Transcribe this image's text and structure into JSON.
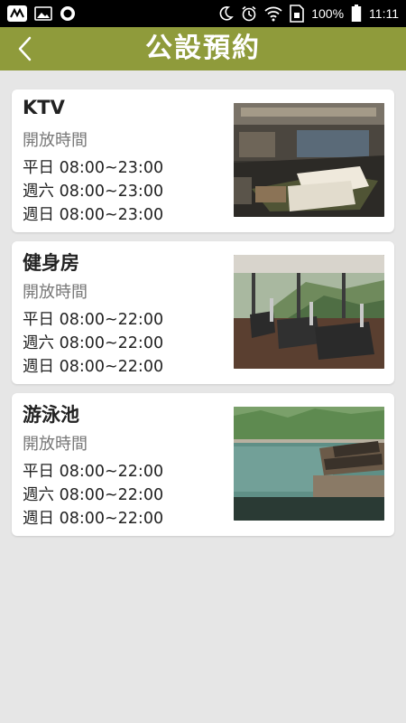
{
  "status_bar": {
    "battery": "100%",
    "time": "11:11",
    "icons": [
      "asus-logo-icon",
      "image-icon",
      "record-icon",
      "moon-icon",
      "alarm-icon",
      "wifi-icon",
      "sim-icon",
      "battery-icon"
    ]
  },
  "header": {
    "title": "公設預約",
    "back_icon": "chevron-left-icon",
    "color": "#8f9b3b"
  },
  "facilities": [
    {
      "name": "KTV",
      "subtitle": "開放時間",
      "hours": [
        "平日 08:00~23:00",
        "週六 08:00~23:00",
        "週日 08:00~23:00"
      ],
      "image": "ktv-room-photo"
    },
    {
      "name": "健身房",
      "subtitle": "開放時間",
      "hours": [
        "平日 08:00~22:00",
        "週六 08:00~22:00",
        "週日 08:00~22:00"
      ],
      "image": "gym-photo"
    },
    {
      "name": "游泳池",
      "subtitle": "開放時間",
      "hours": [
        "平日 08:00~22:00",
        "週六 08:00~22:00",
        "週日 08:00~22:00"
      ],
      "image": "swimming-pool-photo"
    }
  ]
}
